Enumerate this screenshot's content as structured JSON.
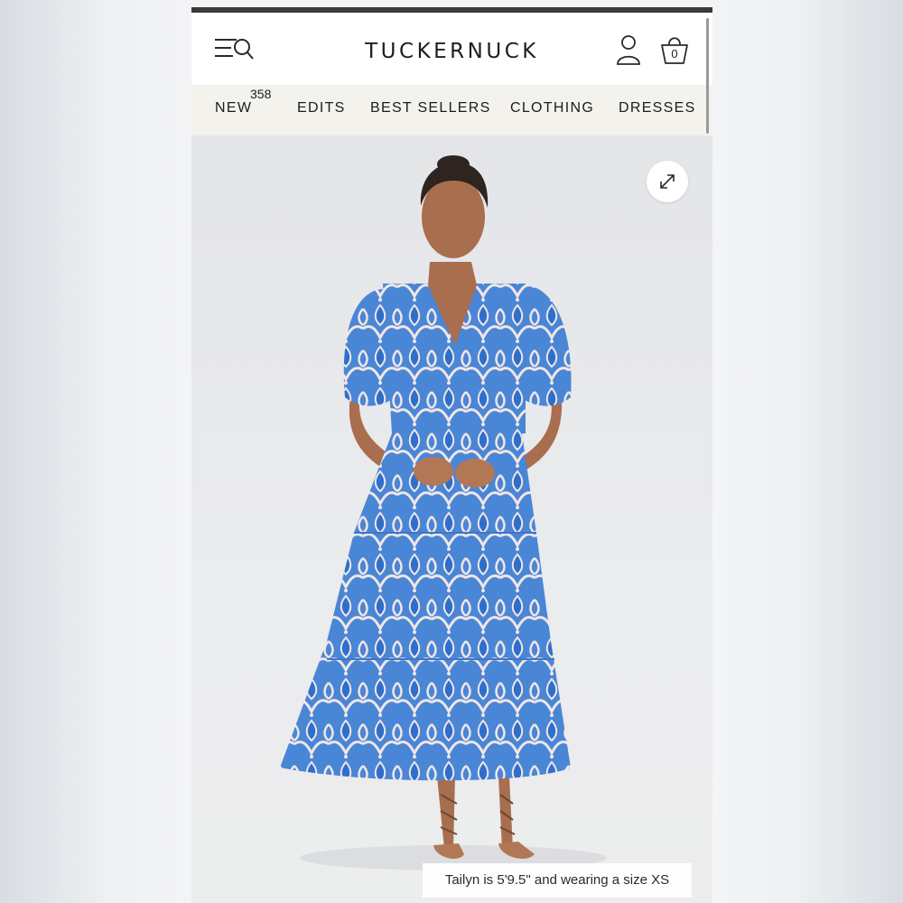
{
  "header": {
    "brand": "TUCKERNUCK",
    "menu_icon": "menu-search-icon",
    "account_icon": "user-icon",
    "bag_icon": "shopping-bag-icon",
    "bag_count": "0"
  },
  "nav": {
    "items": [
      {
        "label": "NEW",
        "badge": "358"
      },
      {
        "label": "EDITS"
      },
      {
        "label": "BEST SELLERS"
      },
      {
        "label": "CLOTHING"
      },
      {
        "label": "DRESSES"
      }
    ]
  },
  "product_image": {
    "expand_icon": "expand-arrows-icon",
    "caption": "Tailyn is 5'9.5\" and wearing a size XS",
    "dress_color": "#4a86d6",
    "print_color": "#f1e6e6"
  },
  "colors": {
    "nav_background": "#f3f2ec",
    "text": "#1e1e1e"
  }
}
